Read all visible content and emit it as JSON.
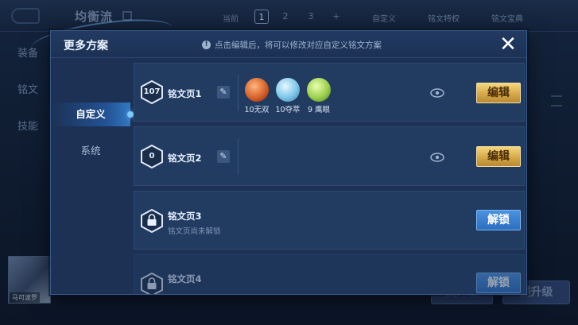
{
  "background": {
    "title": "均衡流",
    "current_label": "当前",
    "pages": [
      "1",
      "2",
      "3",
      "+"
    ],
    "custom_label": "自定义",
    "special_label": "铭文特权",
    "treasure_label": "铭文宝典",
    "left_tabs": [
      "装备",
      "铭文",
      "技能"
    ],
    "hero_name": "马可波罗",
    "upgrade_label": "提升级",
    "upgrade_label2": "提升级"
  },
  "modal": {
    "title": "更多方案",
    "info": "点击编辑后，将可以修改对应自定义铭文方案",
    "close_glyph": "✕",
    "tabs": [
      {
        "label": "自定义",
        "active": true
      },
      {
        "label": "系统",
        "active": false
      }
    ],
    "rows": [
      {
        "level": "107",
        "name": "铭文页1",
        "runes": [
          {
            "label": "10无双",
            "color": "#e0743a"
          },
          {
            "label": "10夺萃",
            "color": "#7cc6e8"
          },
          {
            "label": "9 鹰眼",
            "color": "#9ccf4c"
          }
        ],
        "button": "编辑"
      },
      {
        "level": "0",
        "name": "铭文页2",
        "runes": [],
        "button": "编辑"
      },
      {
        "level": "",
        "name": "铭文页3",
        "subtitle": "铭文页尚未解锁",
        "button": "解锁",
        "locked": true
      },
      {
        "level": "",
        "name": "铭文页4",
        "button": "解锁",
        "locked": true
      }
    ]
  },
  "colors": {
    "gold_button": "#d6a84a",
    "blue_button": "#2d6fc0",
    "panel": "#1c3154"
  }
}
